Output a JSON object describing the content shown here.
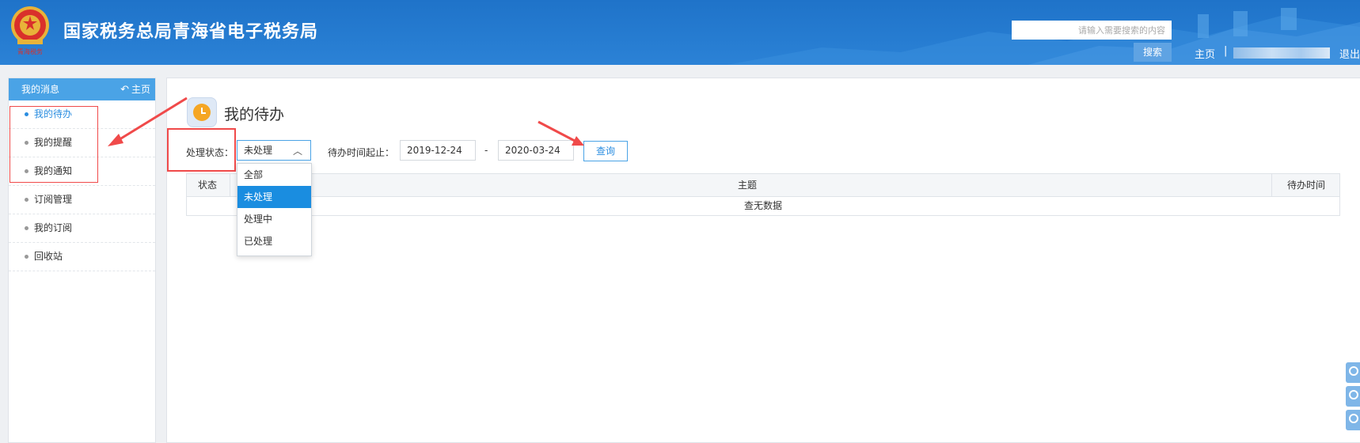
{
  "header": {
    "emblem_caption": "青海税务",
    "title": "国家税务总局青海省电子税务局",
    "search_placeholder": "请输入需要搜索的内容",
    "search_button": "搜索",
    "nav_home": "主页",
    "nav_separator": "|",
    "nav_logout": "退出"
  },
  "sidebar": {
    "title": "我的消息",
    "home_link": "主页",
    "items": [
      {
        "label": "我的待办"
      },
      {
        "label": "我的提醒"
      },
      {
        "label": "我的通知"
      },
      {
        "label": "订阅管理"
      },
      {
        "label": "我的订阅"
      },
      {
        "label": "回收站"
      }
    ]
  },
  "main": {
    "page_title": "我的待办",
    "filter": {
      "status_label": "处理状态：",
      "status_value": "未处理",
      "status_options": [
        "全部",
        "未处理",
        "处理中",
        "已处理"
      ],
      "date_label": "待办时间起止：",
      "date_from": "2019-12-24",
      "date_separator": "-",
      "date_to": "2020-03-24",
      "query_button": "查询"
    },
    "table": {
      "columns": [
        "状态",
        "主题",
        "待办时间"
      ],
      "empty_text": "查无数据"
    }
  },
  "colors": {
    "header_blue": "#2b82d6",
    "accent": "#2a8de0",
    "annotation_red": "#f04a4a"
  }
}
